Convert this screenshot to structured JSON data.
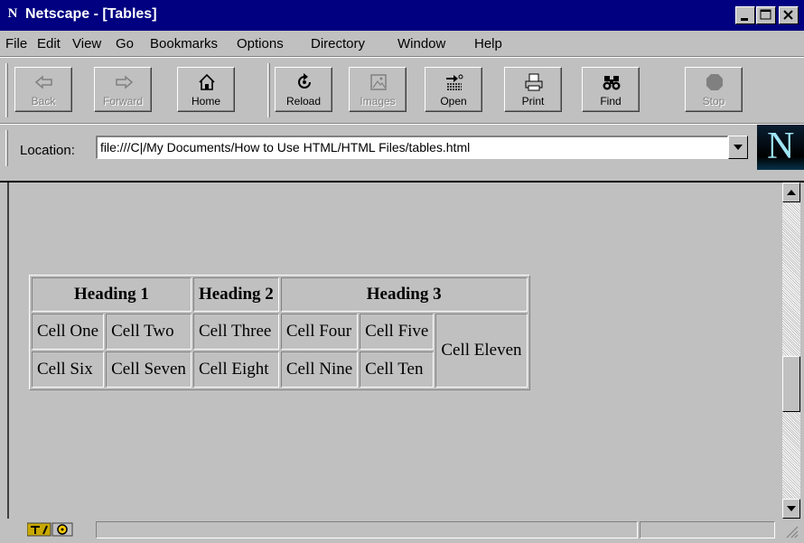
{
  "window": {
    "title": "Netscape - [Tables]",
    "app_icon": "netscape-n-icon"
  },
  "menu": [
    "File",
    "Edit",
    "View",
    "Go",
    "Bookmarks",
    "Options",
    "Directory",
    "Window",
    "Help"
  ],
  "toolbar": {
    "back": "Back",
    "forward": "Forward",
    "home": "Home",
    "reload": "Reload",
    "images": "Images",
    "open": "Open",
    "print": "Print",
    "find": "Find",
    "stop": "Stop"
  },
  "location": {
    "label": "Location:",
    "url": "file:///C|/My Documents/How to Use HTML/HTML Files/tables.html"
  },
  "logo": "N",
  "table": {
    "headings": [
      "Heading 1",
      "Heading 2",
      "Heading 3"
    ],
    "row1": [
      "Cell One",
      "Cell Two",
      "Cell Three",
      "Cell Four",
      "Cell Five",
      "Cell Eleven"
    ],
    "row2": [
      "Cell Six",
      "Cell Seven",
      "Cell Eight",
      "Cell Nine",
      "Cell Ten"
    ]
  },
  "colors": {
    "titlebar": "#000080",
    "chrome": "#c0c0c0"
  }
}
